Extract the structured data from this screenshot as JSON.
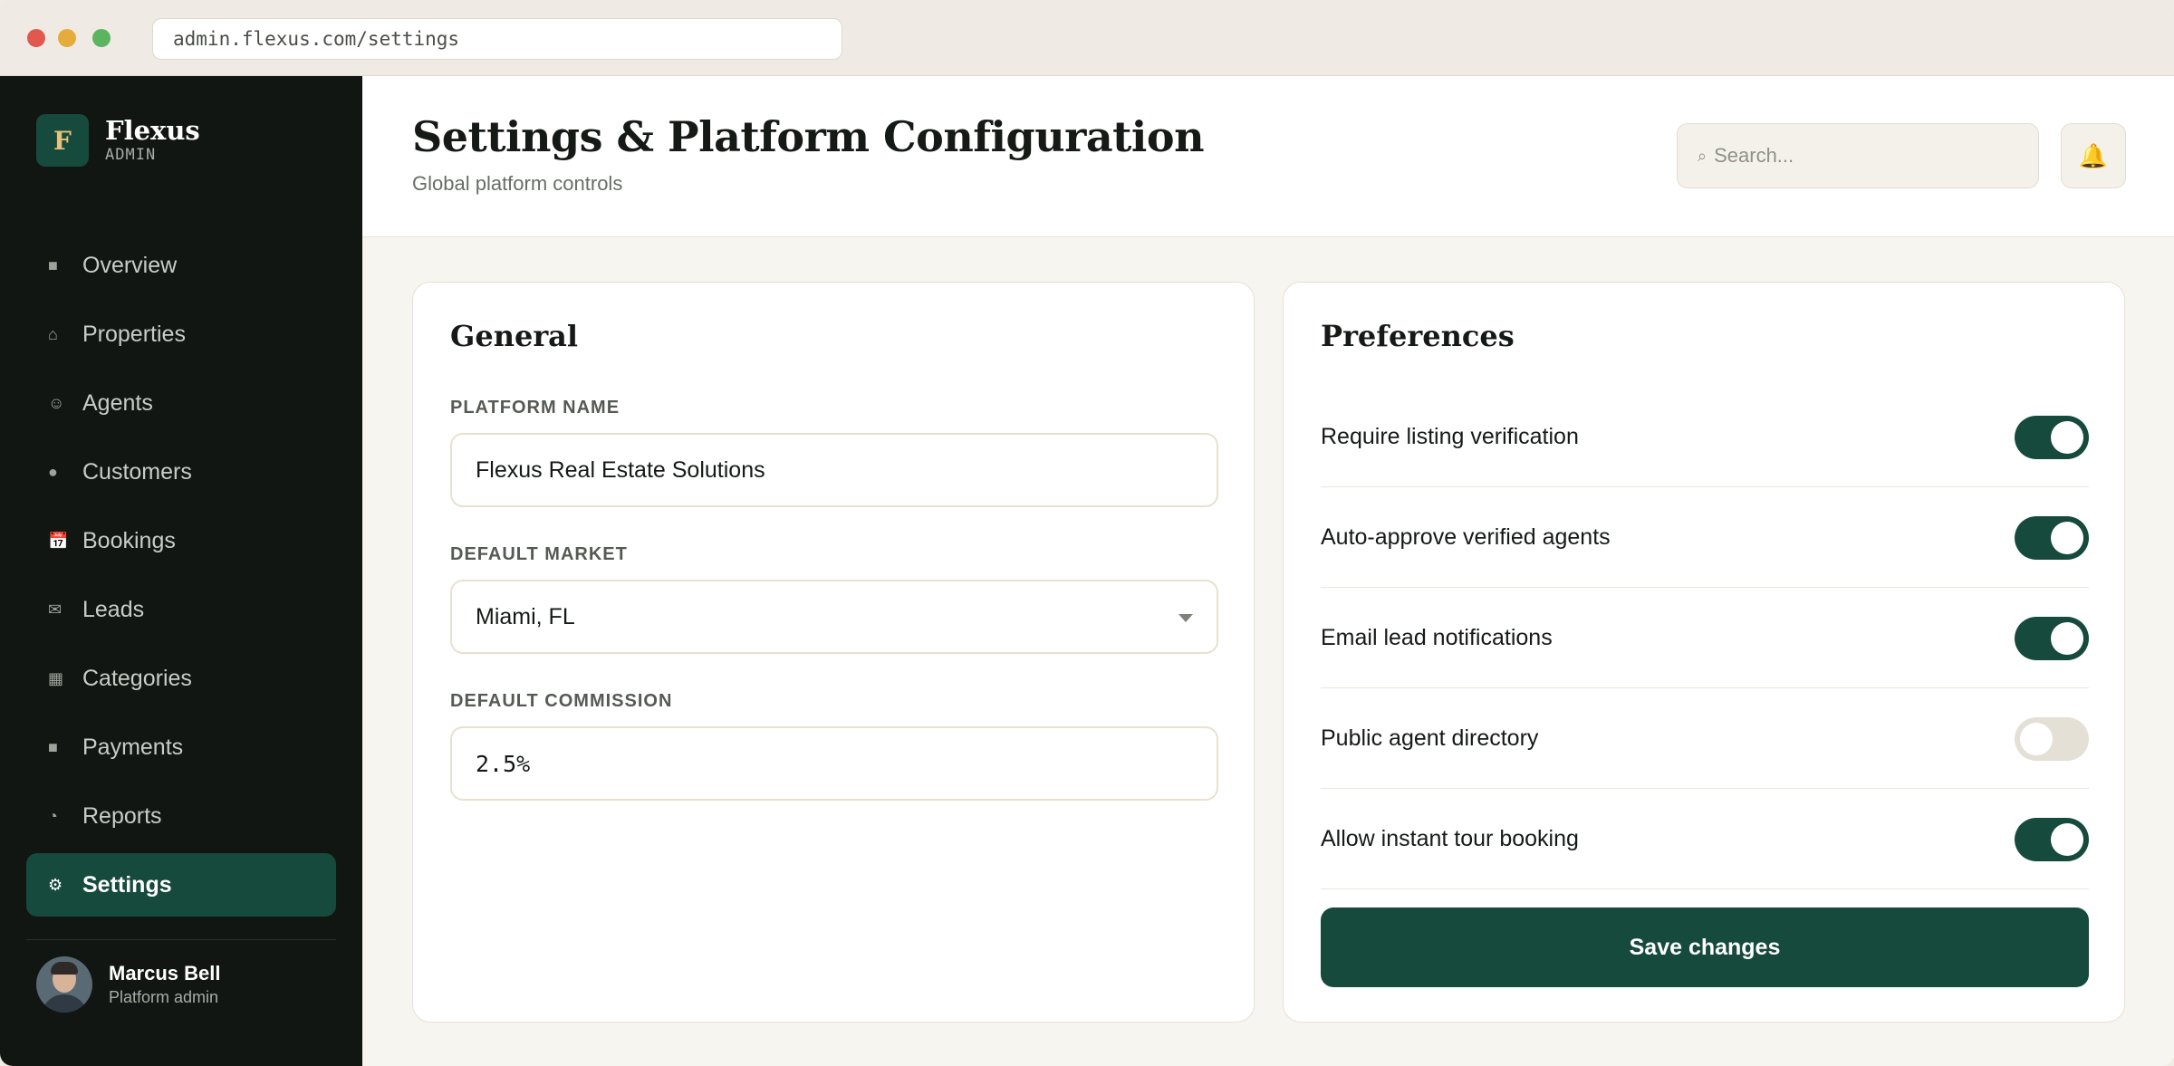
{
  "browser": {
    "url": "admin.flexus.com/settings"
  },
  "brand": {
    "logo_letter": "F",
    "name": "Flexus",
    "subtitle": "ADMIN"
  },
  "sidebar": {
    "items": [
      {
        "label": "Overview",
        "icon": "square-icon",
        "glyph": "■",
        "active": false
      },
      {
        "label": "Properties",
        "icon": "house-icon",
        "glyph": "⌂",
        "active": false
      },
      {
        "label": "Agents",
        "icon": "smiley-icon",
        "glyph": "☺",
        "active": false
      },
      {
        "label": "Customers",
        "icon": "circle-icon",
        "glyph": "●",
        "active": false
      },
      {
        "label": "Bookings",
        "icon": "calendar-icon",
        "glyph": "📅",
        "active": false
      },
      {
        "label": "Leads",
        "icon": "mail-icon",
        "glyph": "✉",
        "active": false
      },
      {
        "label": "Categories",
        "icon": "grid-icon",
        "glyph": "▦",
        "active": false
      },
      {
        "label": "Payments",
        "icon": "square-icon",
        "glyph": "■",
        "active": false
      },
      {
        "label": "Reports",
        "icon": "pie-icon",
        "glyph": "◔",
        "active": false
      },
      {
        "label": "Settings",
        "icon": "gear-icon",
        "glyph": "⚙",
        "active": true
      }
    ]
  },
  "user": {
    "name": "Marcus Bell",
    "role": "Platform admin"
  },
  "header": {
    "title": "Settings & Platform Configuration",
    "subtitle": "Global platform controls",
    "search_placeholder": "Search..."
  },
  "general": {
    "title": "General",
    "platform_name_label": "PLATFORM NAME",
    "platform_name_value": "Flexus Real Estate Solutions",
    "default_market_label": "DEFAULT MARKET",
    "default_market_value": "Miami, FL",
    "default_commission_label": "DEFAULT COMMISSION",
    "default_commission_value": "2.5%"
  },
  "preferences": {
    "title": "Preferences",
    "items": [
      {
        "label": "Require listing verification",
        "on": true
      },
      {
        "label": "Auto-approve verified agents",
        "on": true
      },
      {
        "label": "Email lead notifications",
        "on": true
      },
      {
        "label": "Public agent directory",
        "on": false
      },
      {
        "label": "Allow instant tour booking",
        "on": true
      }
    ],
    "save_label": "Save changes"
  },
  "colors": {
    "accent": "#164a3c",
    "sidebar_bg": "#121612",
    "toggle_off": "#e4e0d6"
  }
}
